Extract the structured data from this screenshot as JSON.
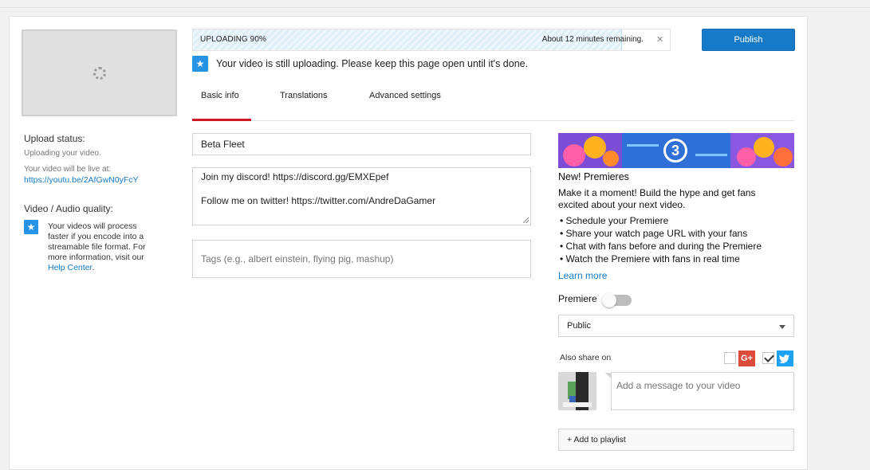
{
  "upload": {
    "progress_label": "UPLOADING 90%",
    "progress_percent": 90,
    "time_remaining": "About 12 minutes remaining.",
    "close_glyph": "×",
    "publish_label": "Publish",
    "notice": "Your video is still uploading. Please keep this page open until it's done."
  },
  "sidebar": {
    "status_heading": "Upload status:",
    "status_text": "Uploading your video.",
    "live_text": "Your video will be live at:",
    "live_url": "https://youtu.be/2AfGwN0yFcY",
    "quality_heading": "Video / Audio quality:",
    "quality_lines": [
      "Your videos will process",
      "faster if you encode into a",
      "streamable file format. For",
      "more information, visit our"
    ],
    "help_link": "Help Center",
    "help_suffix": "."
  },
  "tabs": [
    {
      "label": "Basic info",
      "active": true
    },
    {
      "label": "Translations",
      "active": false
    },
    {
      "label": "Advanced settings",
      "active": false
    }
  ],
  "form": {
    "title_value": "Beta Fleet",
    "description_lines": [
      "Join my discord! https://discord.gg/EMXEpef",
      "",
      "Follow me on twitter! https://twitter.com/AndreDaGamer"
    ],
    "tags_placeholder": "Tags (e.g., albert einstein, flying pig, mashup)"
  },
  "premiere": {
    "banner_number": "3",
    "heading": "New! Premieres",
    "intro_lines": [
      "Make it a moment! Build the hype and get fans",
      "excited about your next video."
    ],
    "bullets": [
      "• Schedule your Premiere",
      "• Share your watch page URL with your fans",
      "• Chat with fans before and during the Premiere",
      "• Watch the Premiere with fans in real time"
    ],
    "learn_more": "Learn more",
    "toggle_label": "Premiere",
    "toggle_on": false
  },
  "visibility": {
    "selected": "Public"
  },
  "share": {
    "label": "Also share on",
    "gplus_glyph": "G+",
    "gplus_checked": false,
    "twitter_checked": true,
    "message_placeholder": "Add a message to your video"
  },
  "playlist": {
    "label": "+ Add to playlist"
  },
  "colors": {
    "accent_blue": "#167ac6",
    "tab_red": "#cc181e",
    "gplus_red": "#dd4b39",
    "twitter_blue": "#1da1f2"
  }
}
